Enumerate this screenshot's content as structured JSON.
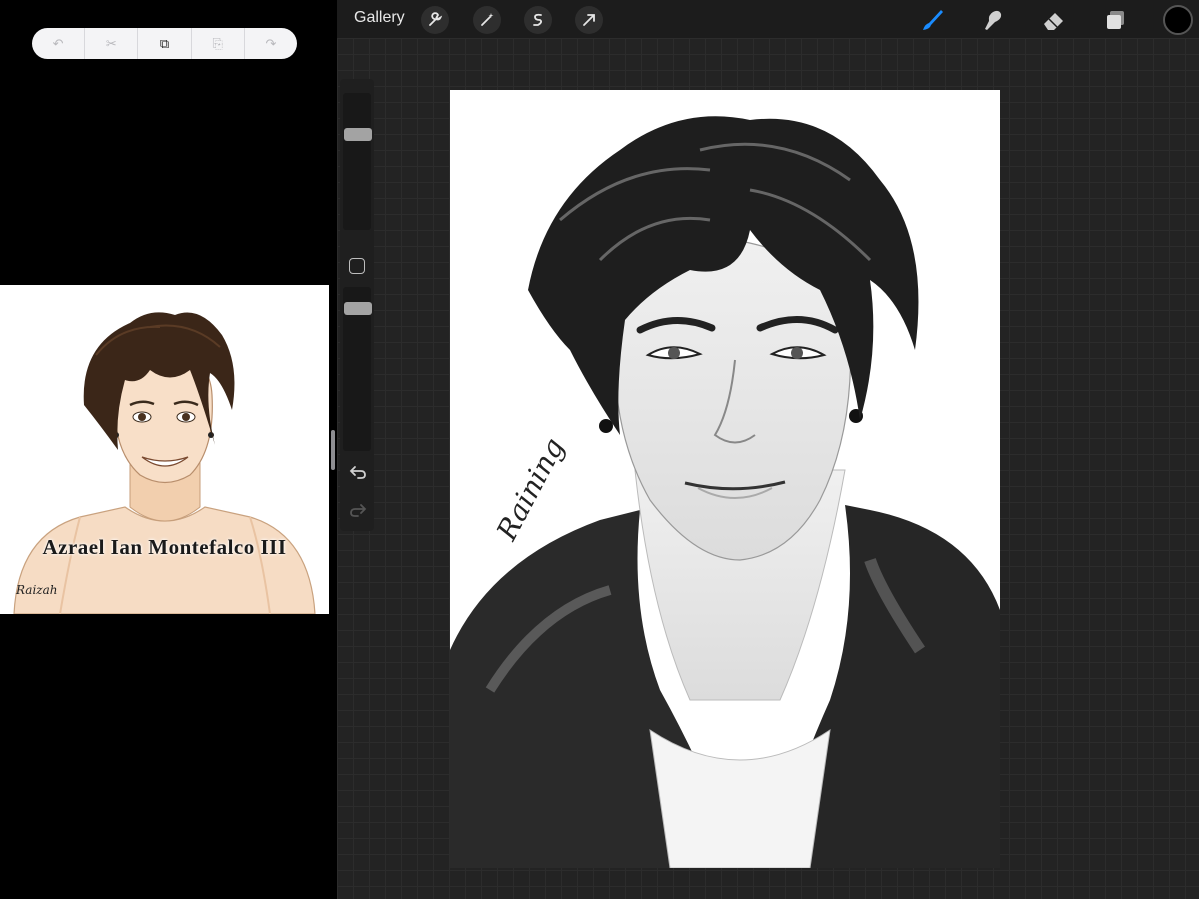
{
  "left_pane": {
    "edit_toolbar": [
      {
        "name": "undo-icon",
        "glyph": "↶"
      },
      {
        "name": "cut-icon",
        "glyph": "✂"
      },
      {
        "name": "copy-icon",
        "glyph": "⧉"
      },
      {
        "name": "paste-icon",
        "glyph": "⎘"
      },
      {
        "name": "redo-icon",
        "glyph": "↷"
      }
    ],
    "reference_image": {
      "caption": "Azrael Ian Montefalco III",
      "signature": "Raizah"
    }
  },
  "app": {
    "gallery_label": "Gallery",
    "left_tools": [
      "wrench-icon",
      "magic-wand-icon",
      "selection-icon",
      "transform-arrow-icon"
    ],
    "right_tools": [
      "brush-icon",
      "smudge-icon",
      "eraser-icon",
      "layers-icon"
    ],
    "active_tool": "brush-icon",
    "colors": {
      "accent": "#1a8cff",
      "current_color": "#000000"
    }
  },
  "sidebar": {
    "brush_size": 0.72,
    "opacity": 0.9
  },
  "artwork": {
    "signature": "Raining"
  }
}
